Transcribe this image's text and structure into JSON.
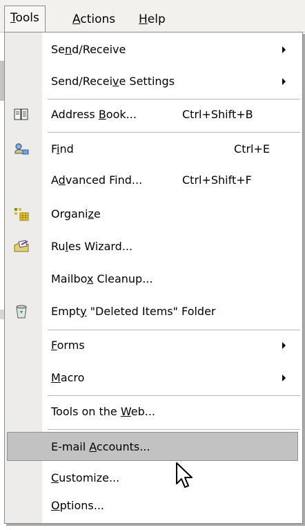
{
  "menubar": {
    "tools": {
      "pre": "",
      "key": "T",
      "post": "ools"
    },
    "actions": {
      "pre": "",
      "key": "A",
      "post": "ctions"
    },
    "help": {
      "pre": "",
      "key": "H",
      "post": "elp"
    }
  },
  "menu": {
    "send_receive": {
      "pre": "Se",
      "key": "n",
      "post": "d/Receive"
    },
    "send_receive_settings": {
      "pre": "Send/Recei",
      "key": "v",
      "post": "e Settings"
    },
    "address_book": {
      "pre": "Address ",
      "key": "B",
      "post": "ook...",
      "shortcut": "Ctrl+Shift+B"
    },
    "find": {
      "pre": "F",
      "key": "i",
      "post": "nd",
      "shortcut": "Ctrl+E"
    },
    "advanced_find": {
      "pre": "A",
      "key": "d",
      "post": "vanced Find...",
      "shortcut": "Ctrl+Shift+F"
    },
    "organize": {
      "pre": "Organi",
      "key": "z",
      "post": "e"
    },
    "rules_wizard": {
      "pre": "Ru",
      "key": "l",
      "post": "es Wizard..."
    },
    "mailbox_cleanup": {
      "pre": "Mailbo",
      "key": "x",
      "post": " Cleanup..."
    },
    "empty_deleted": {
      "pre": "Empt",
      "key": "y",
      "post": " \"Deleted Items\" Folder"
    },
    "forms": {
      "pre": "",
      "key": "F",
      "post": "orms"
    },
    "macro": {
      "pre": "",
      "key": "M",
      "post": "acro"
    },
    "tools_on_web": {
      "pre": "Tools on the ",
      "key": "W",
      "post": "eb..."
    },
    "email_accounts": {
      "pre": "E-mail ",
      "key": "A",
      "post": "ccounts..."
    },
    "customize": {
      "pre": "",
      "key": "C",
      "post": "ustomize..."
    },
    "options": {
      "pre": "",
      "key": "O",
      "post": "ptions..."
    }
  },
  "colors": {
    "menu_background": "#ffffff",
    "icon_gutter": "#edecea",
    "selected_item": "#c2c2c2"
  },
  "icons": [
    "address-book-icon",
    "find-icon",
    "organize-icon",
    "rules-wizard-icon",
    "recycle-bin-icon",
    "mouse-pointer-icon"
  ]
}
